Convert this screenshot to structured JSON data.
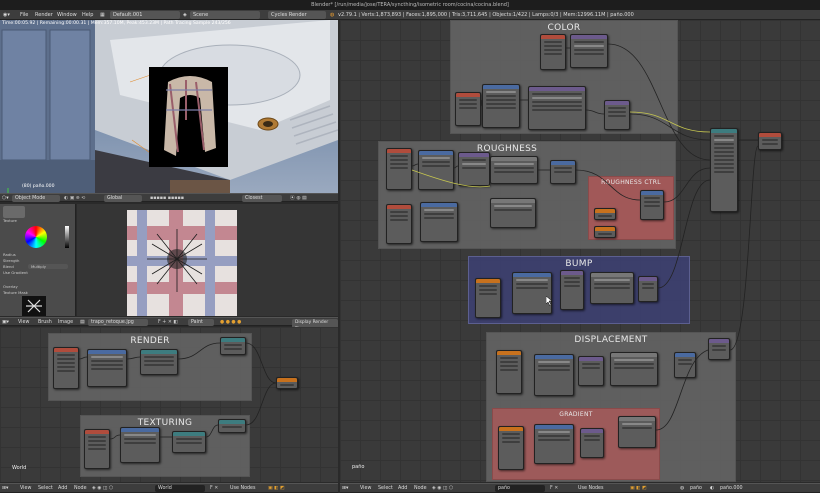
{
  "window": {
    "title": "Blender* [/run/media/jose/TERA/syncthing/isometric room/cocina/cocina.blend]"
  },
  "topbar": {
    "menus": [
      "File",
      "Render",
      "Window",
      "Help"
    ],
    "screen_layout": "Default.001",
    "scene": "Scene",
    "render_engine": "Cycles Render",
    "version": "v2.79.1",
    "stats": "Verts:1,873,893 | Faces:1,895,000 | Tris:3,711,645 | Objects:1/422 | Lamps:0/3 | Mem:12996.11M | paño.000"
  },
  "viewport3d": {
    "render_info": "Time:00:05.92 | Remaining:00:00.31 | Mem:357.10M, Peak:453.23M | Path Tracing Sample 243/256",
    "object_label": "(80) paño.000",
    "header": {
      "mode": "Object Mode",
      "orientation": "Global",
      "overlay": "Closest"
    }
  },
  "sidebar_panel": {
    "rows": [
      "Texture",
      "Radius",
      "Strength",
      "Blend",
      "Use Gradient",
      "Overlay",
      "Texture Mask"
    ],
    "blend_value": "Multiply"
  },
  "image_editor": {
    "header": {
      "menus": [
        "View",
        "Brush",
        "Image"
      ],
      "image_name": "trapo_retoque.jpg",
      "mode": "Paint",
      "display": "Display Render Time"
    }
  },
  "node_editor_left": {
    "frames": [
      "RENDER",
      "TEXTURING"
    ],
    "footer_label": "World",
    "header": {
      "menus": [
        "View",
        "Select",
        "Add",
        "Node"
      ],
      "datablock": "World",
      "use_nodes": "Use Nodes"
    }
  },
  "node_editor_right": {
    "frames": [
      "COLOR",
      "ROUGHNESS",
      "ROUGHNESS CTRL",
      "BUMP",
      "DISPLACEMENT",
      "GRADIENT"
    ],
    "footer_label": "paño",
    "header": {
      "menus": [
        "View",
        "Select",
        "Add",
        "Node"
      ],
      "datablock": "paño",
      "use_nodes": "Use Nodes",
      "material_slot": "paño",
      "material": "paño.000"
    }
  },
  "colors": {
    "frame_gray": "#666666",
    "frame_red": "#a45a5a",
    "frame_blue": "#3c3f6e",
    "node_teal": "#3d7c7f",
    "node_orange": "#c7711d"
  }
}
